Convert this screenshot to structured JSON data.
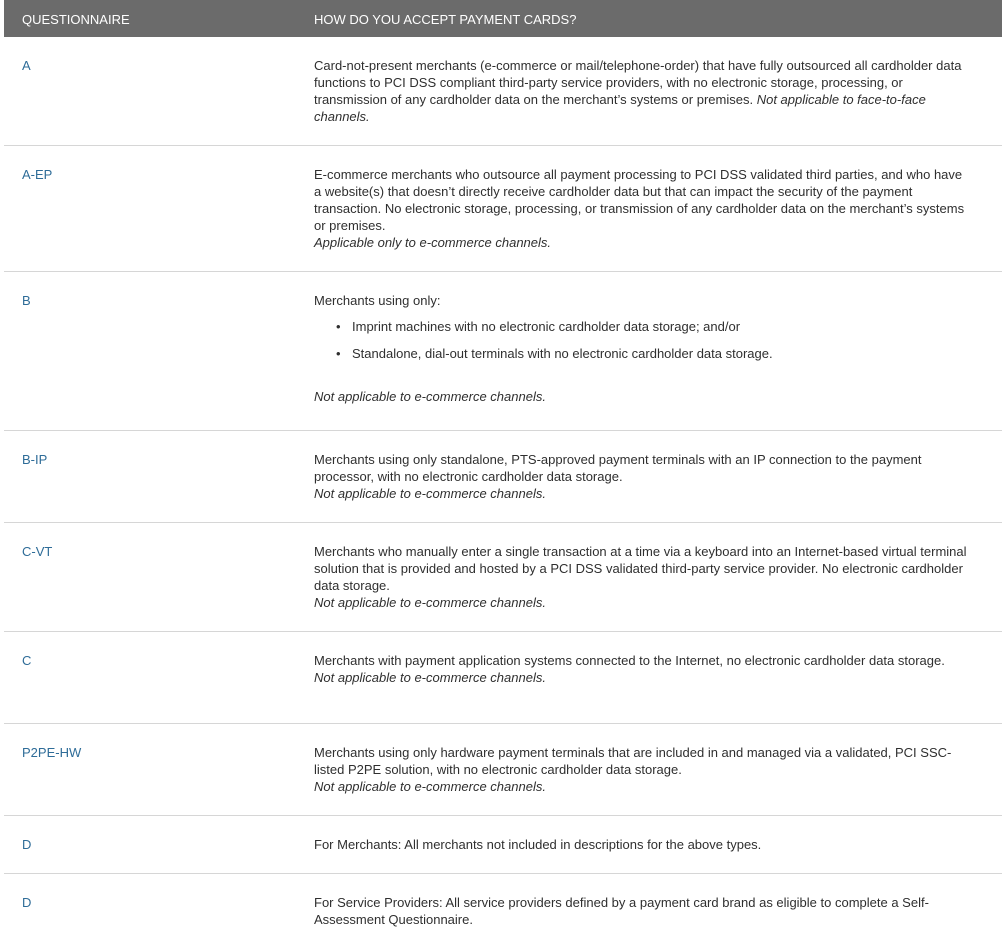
{
  "header": {
    "col1": "QUESTIONNAIRE",
    "col2": "HOW DO YOU ACCEPT PAYMENT CARDS?"
  },
  "rows": [
    {
      "code": "A",
      "text": "Card-not-present merchants (e-commerce or mail/telephone-order) that have fully outsourced all cardholder data functions to PCI DSS compliant third-party service providers, with no electronic storage, processing, or transmission of any cardholder data on the merchant’s systems or premises.",
      "note": "Not applicable to face-to-face channels."
    },
    {
      "code": "A-EP",
      "text": "E-commerce merchants who outsource all payment processing to PCI DSS validated third parties, and who have a website(s) that doesn’t directly receive cardholder data but that can impact the security of the payment transaction. No electronic storage, processing, or transmission of any cardholder data on the merchant’s systems or premises.",
      "note": "Applicable only to e-commerce channels."
    },
    {
      "code": "B",
      "text": "Merchants using only:",
      "bullets": [
        "Imprint machines with no electronic cardholder data storage; and/or",
        "Standalone, dial-out terminals with no electronic cardholder data storage."
      ],
      "note": "Not applicable to e-commerce channels."
    },
    {
      "code": "B-IP",
      "text": "Merchants using only standalone, PTS-approved payment terminals with an IP connection to the payment processor, with no electronic cardholder data storage.",
      "note": "Not applicable to e-commerce channels."
    },
    {
      "code": "C-VT",
      "text": "Merchants who manually enter a single transaction at a time via a keyboard into an Internet-based virtual terminal solution that is provided and hosted by a PCI DSS validated third-party service provider. No electronic cardholder data storage.",
      "note": "Not applicable to e-commerce channels."
    },
    {
      "code": "C",
      "text": "Merchants with payment application systems connected to the Internet, no electronic cardholder data storage.",
      "note": "Not applicable to e-commerce channels."
    },
    {
      "code": "P2PE-HW",
      "text": "Merchants using only hardware payment terminals that are included in and managed via a validated, PCI SSC-listed P2PE solution, with no electronic cardholder data storage.",
      "note": "Not applicable to e-commerce channels."
    },
    {
      "code": "D",
      "text": "For Merchants: All merchants not included in descriptions for the above types."
    },
    {
      "code": "D",
      "text": "For Service Providers: All service providers defined by a payment card brand as eligible to complete a Self-Assessment Questionnaire."
    }
  ]
}
